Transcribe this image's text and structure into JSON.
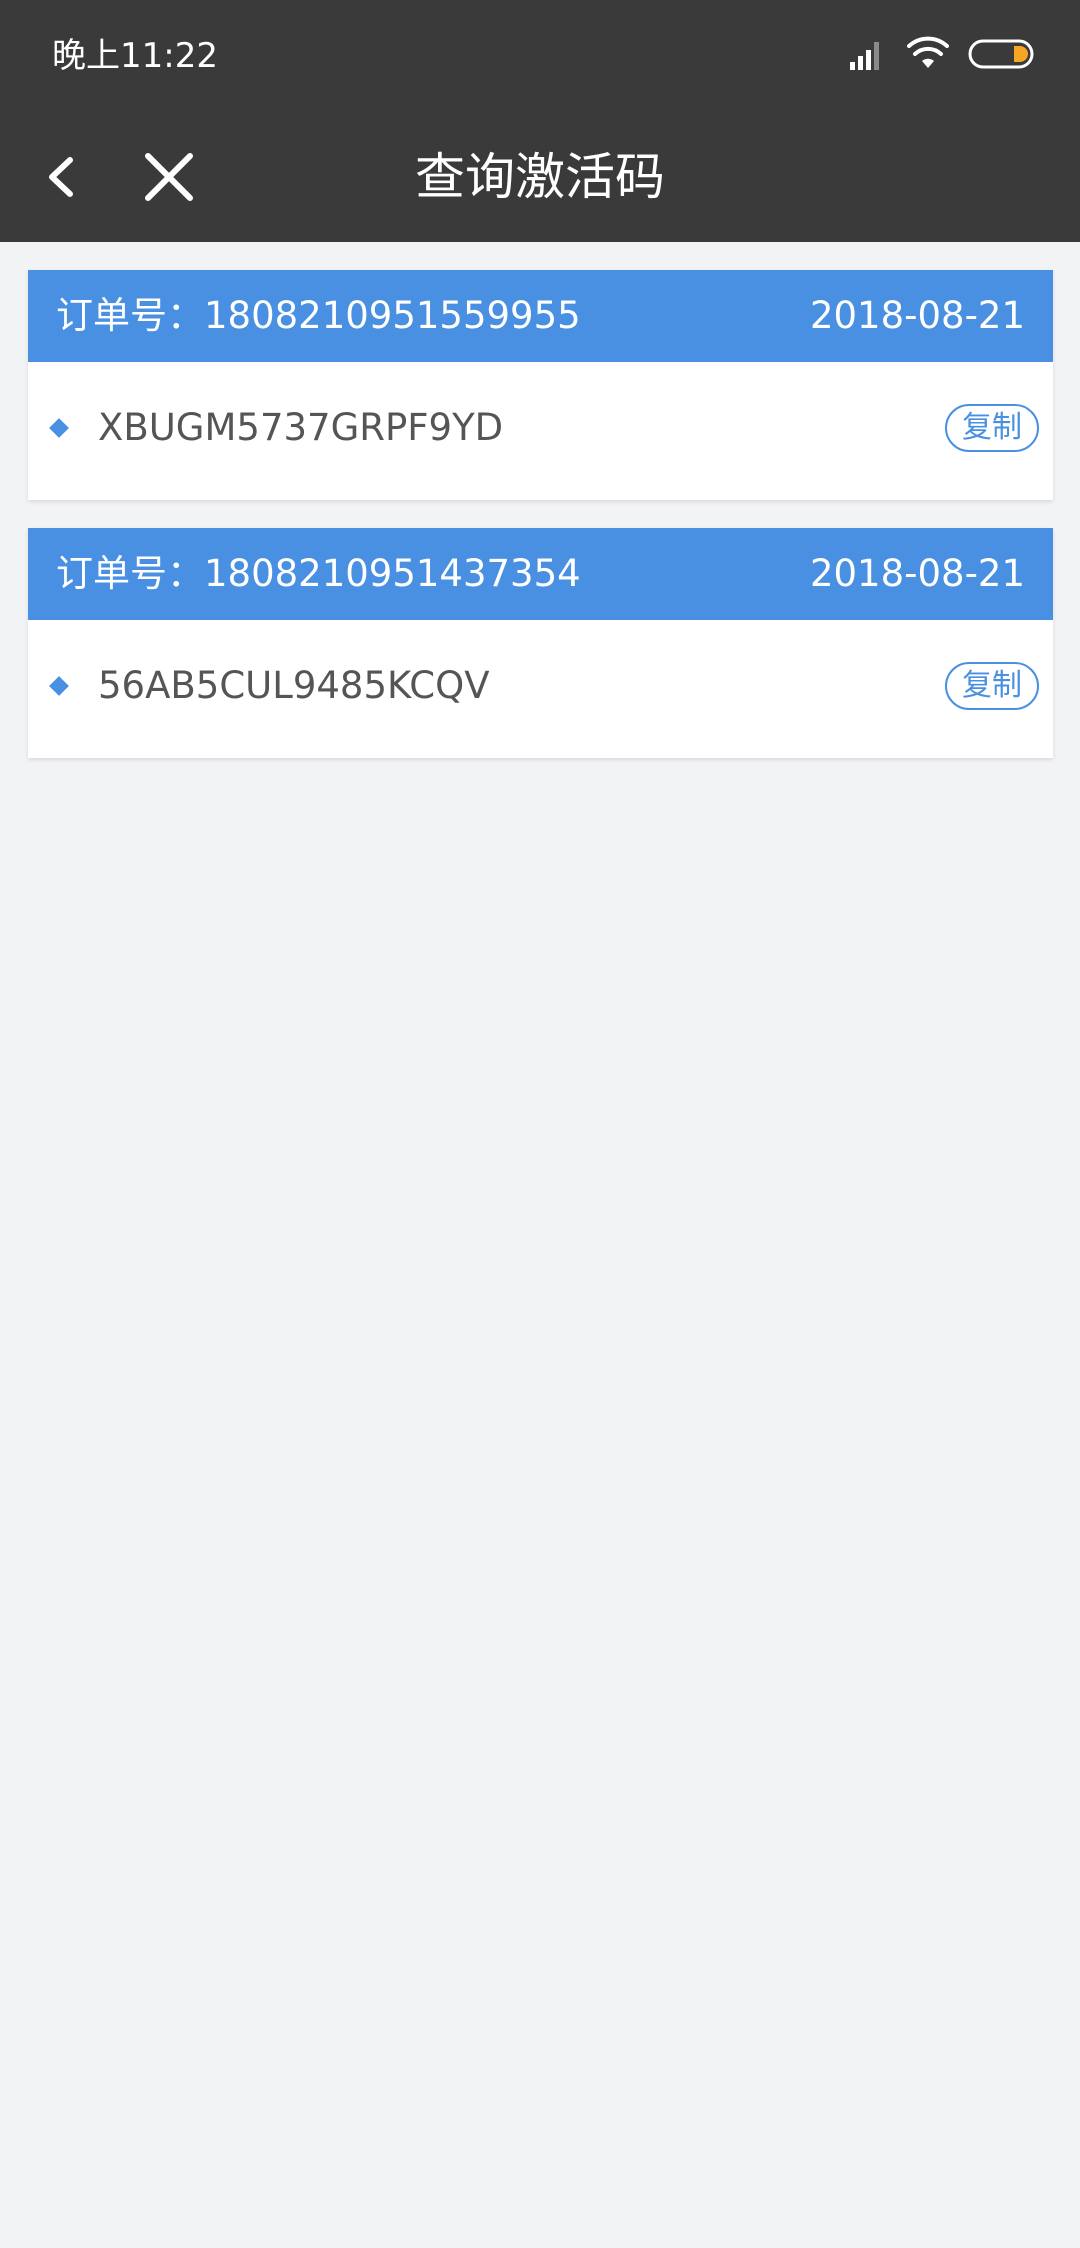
{
  "status_bar": {
    "time": "晚上11:22",
    "battery_accent": "#f5a623"
  },
  "nav": {
    "title": "查询激活码",
    "back_icon": "chevron-left-icon",
    "close_icon": "close-icon"
  },
  "colors": {
    "header_bg": "#3a3a3a",
    "accent": "#4a90e2",
    "page_bg": "#f2f3f5",
    "code_text": "#555555"
  },
  "orders": [
    {
      "label": "订单号：1808210951559955",
      "date": "2018-08-21",
      "code": "XBUGM5737GRPF9YD",
      "copy_label": "复制"
    },
    {
      "label": "订单号：1808210951437354",
      "date": "2018-08-21",
      "code": "56AB5CUL9485KCQV",
      "copy_label": "复制"
    }
  ]
}
